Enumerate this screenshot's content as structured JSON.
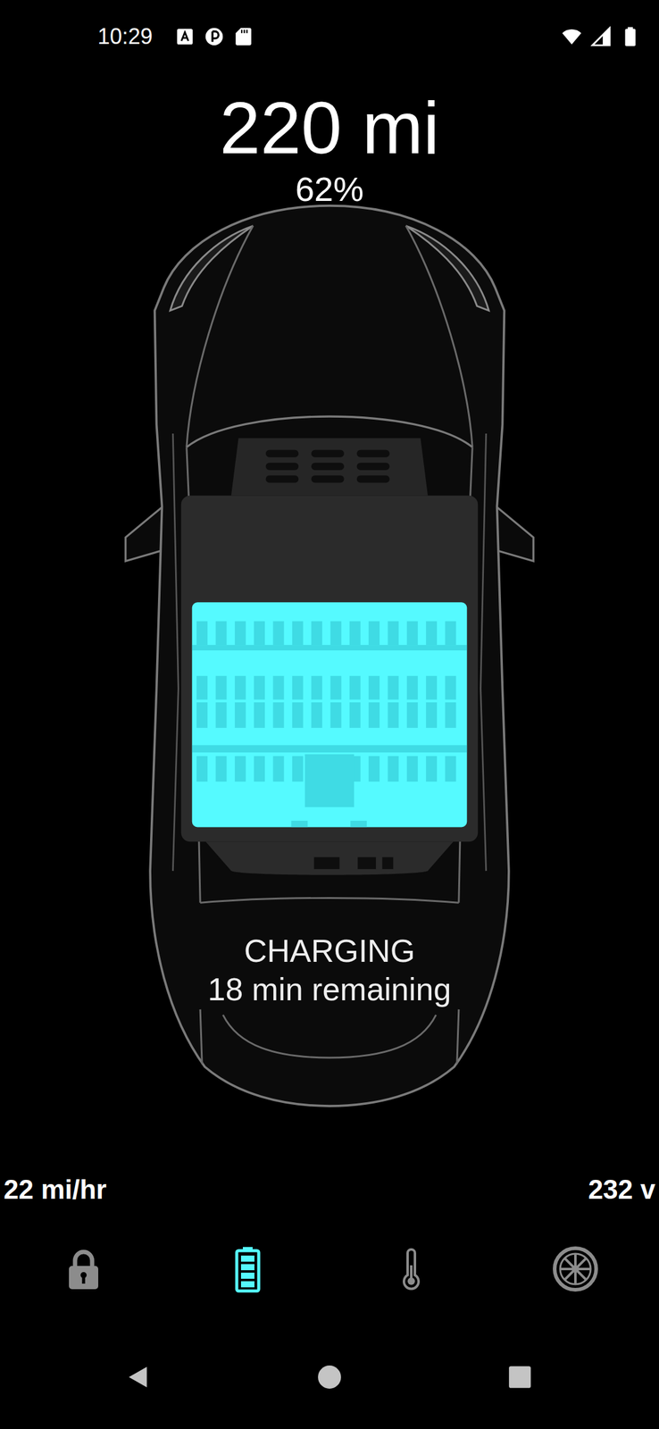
{
  "status_bar": {
    "time": "10:29"
  },
  "range": {
    "distance": "220 mi",
    "percent": "62%"
  },
  "battery": {
    "level": 0.62,
    "charging": true
  },
  "charge_status": {
    "state": "CHARGING",
    "remaining": "18 min remaining"
  },
  "stats": {
    "rate": "22 mi/hr",
    "voltage": "232 v"
  },
  "tabs": [
    {
      "kind": "lock",
      "selected": false
    },
    {
      "kind": "battery",
      "selected": true
    },
    {
      "kind": "climate",
      "selected": false
    },
    {
      "kind": "wheels",
      "selected": false
    }
  ]
}
